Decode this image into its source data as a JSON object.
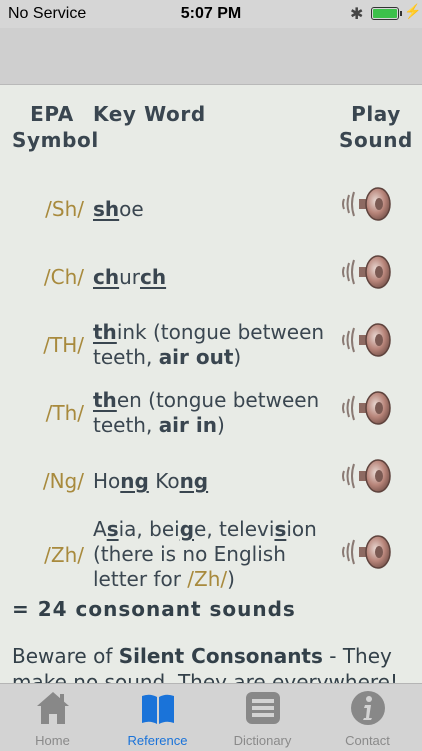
{
  "status": {
    "carrier": "No Service",
    "time": "5:07 PM",
    "bluetooth_icon": "bluetooth-icon",
    "battery_icon": "battery-icon",
    "battery_level": 1.0
  },
  "table": {
    "header": {
      "symbol": [
        "EPA",
        "Symbol"
      ],
      "keyword": "Key Word",
      "sound": [
        "Play",
        "Sound"
      ]
    },
    "rows": [
      {
        "symbol": "/Sh/",
        "keyword": "shoe"
      },
      {
        "symbol": "/Ch/",
        "keyword": "church"
      },
      {
        "symbol": "/TH/",
        "keyword": "think (tongue between teeth, air out)"
      },
      {
        "symbol": "/Th/",
        "keyword": "then (tongue between teeth, air in)"
      },
      {
        "symbol": "/Ng/",
        "keyword": "Hong Kong"
      },
      {
        "symbol": "/Zh/",
        "keyword": "Asia, beige, television (there is no English letter for /Zh/)"
      }
    ],
    "total": "= 24 consonant sounds"
  },
  "note": "Beware of Silent Consonants - They make no sound. They are everywhere!",
  "tabs": [
    {
      "label": "Home",
      "icon": "home-icon",
      "active": false
    },
    {
      "label": "Reference",
      "icon": "book-icon",
      "active": true
    },
    {
      "label": "Dictionary",
      "icon": "list-icon",
      "active": false
    },
    {
      "label": "Contact",
      "icon": "info-icon",
      "active": false
    }
  ],
  "colors": {
    "accent": "#1a73d9",
    "symbol": "#a88a3d",
    "text": "#334049",
    "background": "#e8ebe6"
  }
}
